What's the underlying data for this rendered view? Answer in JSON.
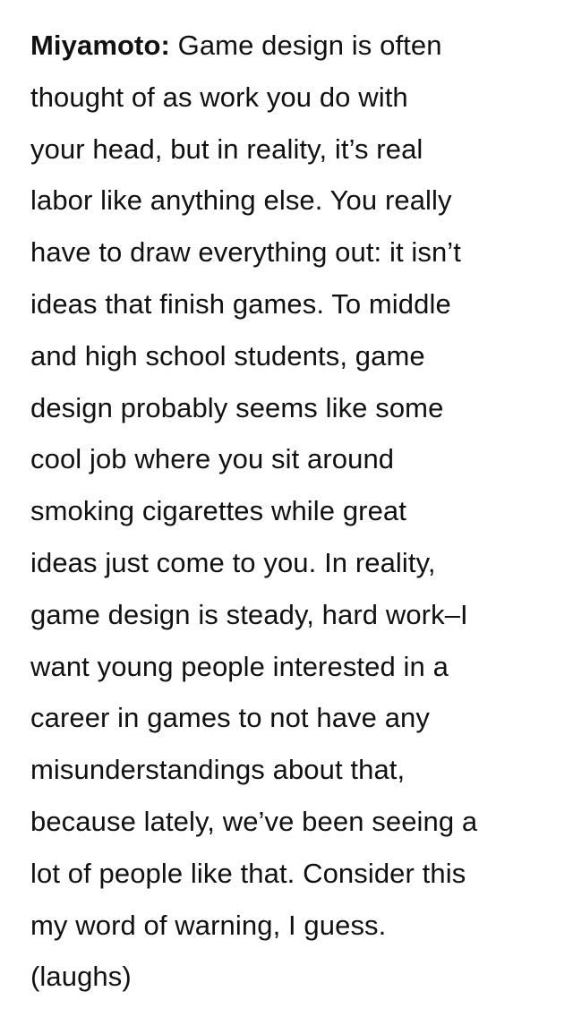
{
  "quote": {
    "speaker": "Miyamoto:",
    "text": " Game design is often\nthought of as work you do with\nyour head, but in reality, it’s real\nlabor like anything else. You really\nhave to draw everything out: it isn’t\nideas that finish games. To middle\nand high school students, game\ndesign probably seems like some\ncool job where you sit around\nsmoking cigarettes while great\nideas just come to you. In reality,\ngame design is steady, hard work–I\nwant young people interested in a\ncareer in games to not have any\nmisunderstandings about that,\nbecause lately, we’ve been seeing a\nlot of people like that. Consider this\nmy word of warning, I guess.\n(laughs)"
  }
}
